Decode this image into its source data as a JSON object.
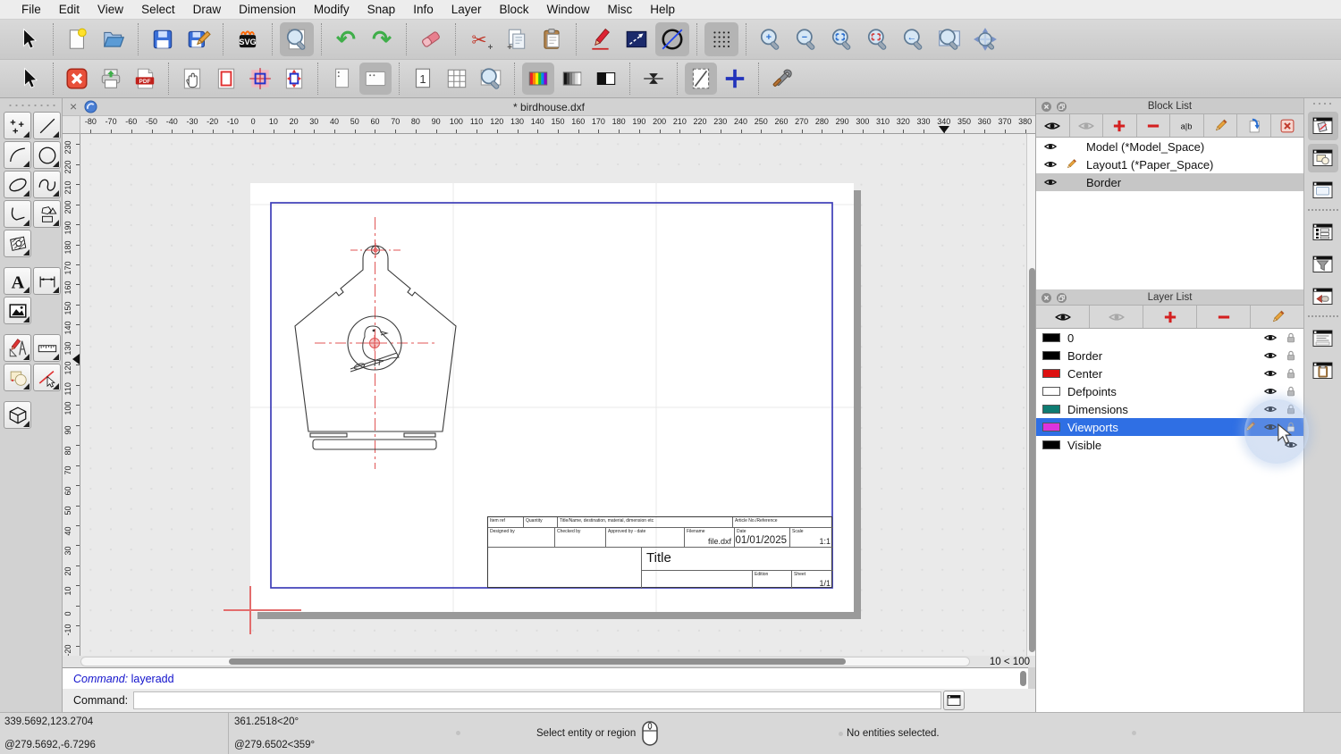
{
  "window": {
    "tab_title": "* birdhouse.dxf"
  },
  "menu": {
    "items": [
      "File",
      "Edit",
      "View",
      "Select",
      "Draw",
      "Dimension",
      "Modify",
      "Snap",
      "Info",
      "Layer",
      "Block",
      "Window",
      "Misc",
      "Help"
    ]
  },
  "toolbar_top": {
    "items": [
      {
        "icon": "pointer"
      },
      {
        "icon": "file-new",
        "sep": true
      },
      {
        "icon": "folder-open"
      },
      {
        "icon": "save",
        "sep": true
      },
      {
        "icon": "save-as"
      },
      {
        "icon": "svg-export",
        "sep": true
      },
      {
        "icon": "print-preview",
        "sep": true,
        "active": true
      },
      {
        "icon": "undo",
        "sep": true
      },
      {
        "icon": "redo"
      },
      {
        "icon": "eraser",
        "sep": true
      },
      {
        "icon": "cut",
        "sep": true
      },
      {
        "icon": "copy"
      },
      {
        "icon": "paste"
      },
      {
        "icon": "pencil-red",
        "sep": true
      },
      {
        "icon": "select-rect"
      },
      {
        "icon": "construction",
        "active": true
      },
      {
        "icon": "grid",
        "sep": true,
        "active": true
      },
      {
        "icon": "zoom-in",
        "sep": true
      },
      {
        "icon": "zoom-out"
      },
      {
        "icon": "zoom-auto"
      },
      {
        "icon": "zoom-select"
      },
      {
        "icon": "zoom-prev"
      },
      {
        "icon": "zoom-window"
      },
      {
        "icon": "zoom-pan"
      }
    ]
  },
  "toolbar_print": {
    "items": [
      {
        "icon": "pointer"
      },
      {
        "icon": "close-doc",
        "sep": true
      },
      {
        "icon": "print"
      },
      {
        "icon": "pdf"
      },
      {
        "icon": "pan-hand",
        "sep": true
      },
      {
        "icon": "paper-border"
      },
      {
        "icon": "fit-paper"
      },
      {
        "icon": "scale-viewport"
      },
      {
        "icon": "page-portrait",
        "sep": true
      },
      {
        "icon": "page-landscape",
        "active": true
      },
      {
        "icon": "page-single",
        "sep": true
      },
      {
        "icon": "page-multi"
      },
      {
        "icon": "zoom-page"
      },
      {
        "icon": "color-mode",
        "sep": true,
        "active": true
      },
      {
        "icon": "grayscale-mode"
      },
      {
        "icon": "bw-mode"
      },
      {
        "icon": "vrefresh",
        "sep": true
      },
      {
        "icon": "draft-mode",
        "sep": true,
        "active": true
      },
      {
        "icon": "crosshair-blue"
      },
      {
        "icon": "settings",
        "sep": true
      }
    ]
  },
  "palette": {
    "groups": [
      [
        [
          "points",
          "line"
        ],
        [
          "arc",
          "circle"
        ],
        [
          "ellipse",
          "spline"
        ],
        [
          "polyline",
          "polygon"
        ],
        [
          "hatch"
        ]
      ],
      [
        [
          "text-tool",
          "dimension"
        ],
        [
          "image-tool"
        ]
      ],
      [
        [
          "modify",
          "measure"
        ],
        [
          "order",
          "select-entity"
        ]
      ],
      [
        [
          "solid3d"
        ]
      ]
    ]
  },
  "rulers": {
    "top": {
      "from": -80,
      "to": 380,
      "step": 10,
      "pointer": 340
    },
    "left": {
      "from": 230,
      "to": -20,
      "step": 10,
      "pointer": 123
    }
  },
  "block_list": {
    "title": "Block List",
    "toolbar_icons": [
      "eye",
      "eye-off",
      "plus-red",
      "minus-red",
      "rename",
      "pencil-edit",
      "insert-block",
      "remove-block"
    ],
    "items": [
      {
        "label": "Model (*Model_Space)",
        "eye": true,
        "pencil": false,
        "selected": false
      },
      {
        "label": "Layout1 (*Paper_Space)",
        "eye": true,
        "pencil": true,
        "selected": false
      },
      {
        "label": "Border",
        "eye": true,
        "pencil": false,
        "selected": true
      }
    ]
  },
  "layer_list": {
    "title": "Layer List",
    "toolbar_icons": [
      "eye",
      "eye-off",
      "plus-red",
      "minus-red",
      "pencil-edit"
    ],
    "layers": [
      {
        "name": "0",
        "color": "#000000",
        "eye": true,
        "lock": true,
        "pencil": false,
        "selected": false
      },
      {
        "name": "Border",
        "color": "#000000",
        "eye": true,
        "lock": true,
        "pencil": false,
        "selected": false
      },
      {
        "name": "Center",
        "color": "#dd1111",
        "eye": true,
        "lock": true,
        "pencil": false,
        "selected": false
      },
      {
        "name": "Defpoints",
        "color": "#ffffff",
        "eye": true,
        "lock": true,
        "pencil": false,
        "selected": false
      },
      {
        "name": "Dimensions",
        "color": "#0e7c72",
        "eye": true,
        "lock": true,
        "pencil": false,
        "selected": false
      },
      {
        "name": "Viewports",
        "color": "#dd33dd",
        "eye": true,
        "lock": true,
        "pencil": true,
        "selected": true
      },
      {
        "name": "Visible",
        "color": "#000000",
        "eye": true,
        "lock": false,
        "pencil": false,
        "selected": false
      }
    ]
  },
  "dock_toggles": {
    "items": [
      {
        "icon": "dock-block",
        "active": true
      },
      {
        "icon": "dock-layer",
        "active": true
      },
      {
        "icon": "dock-library"
      },
      {
        "divider": true
      },
      {
        "icon": "dock-entity"
      },
      {
        "icon": "dock-filter"
      },
      {
        "icon": "dock-quick"
      },
      {
        "divider": true
      },
      {
        "icon": "dock-command"
      },
      {
        "icon": "dock-clipboard"
      }
    ]
  },
  "command": {
    "history_label": "Command:",
    "history_value": "layeradd",
    "prompt_label": "Command:",
    "input_value": ""
  },
  "scrollbar": {
    "range_label": "10 < 100"
  },
  "status": {
    "abs_coord": "339.5692,123.2704",
    "rel_coord": "@279.5692,-6.7296",
    "polar_coord": "361.2518<20°",
    "polar_rel": "@279.6502<359°",
    "hint": "Select entity or region",
    "selection": "No entities selected."
  },
  "title_block": {
    "item_ref": "Item ref",
    "quantity": "Quantity",
    "title_name": "Title/Name, destination, material, dimension etc",
    "article": "Article No./Reference",
    "designed_by": "Designed by",
    "checked_by": "Checked by",
    "approved_by": "Approved by - date",
    "filename_label": "Filename",
    "filename_value": "file.dxf",
    "date_label": "Date",
    "date_value": "01/01/2025",
    "scale_label": "Scale",
    "scale_value": "1:1",
    "title": "Title",
    "edition_label": "Edition",
    "sheet_label": "Sheet",
    "sheet_value": "1/1"
  },
  "colors": {
    "selection_blue": "#2f6fe4",
    "paper_border_blue": "#3d3db8",
    "centerline_red": "#e05555"
  }
}
